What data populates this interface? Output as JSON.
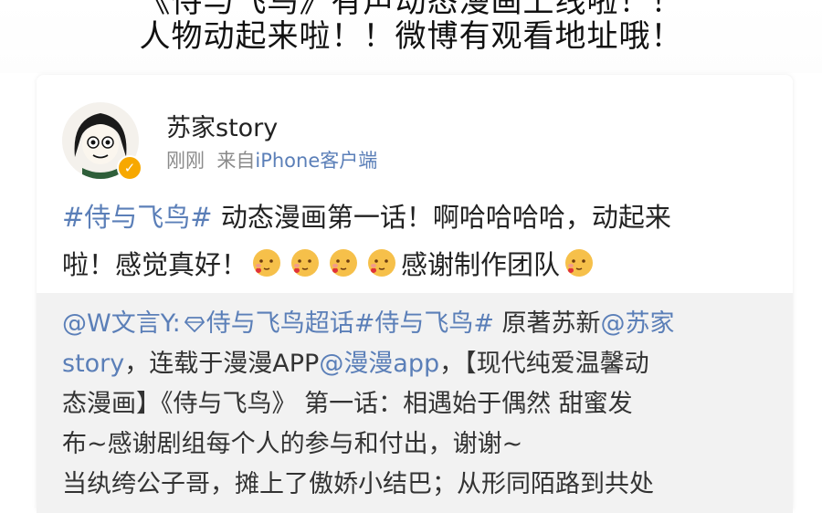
{
  "banner": {
    "line1": "《侍与飞鸟》有声动态漫画上线啦！！",
    "line2": "人物动起来啦！！微博有观看地址哦！"
  },
  "post": {
    "username": "苏家story",
    "time": "刚刚",
    "source_prefix": "来自",
    "source": "iPhone客户端",
    "topic": "#侍与飞鸟#",
    "text_1": " 动态漫画第一话！啊哈哈哈哈，动起来",
    "text_2": "啦！感觉真好！",
    "text_3": "感谢制作团队",
    "emoji_icon": "face-with-heart-emoji"
  },
  "repost": {
    "author": "@W文言Y:",
    "supertopic_icon": "diamond-icon",
    "supertopic": "侍与飞鸟超话",
    "topic": "#侍与飞鸟#",
    "text_1": " 原著苏新",
    "mention_1": "@苏家",
    "mention_1b": "story",
    "text_2": "，连载于漫漫APP",
    "mention_2": "@漫漫app",
    "text_3": "，【现代纯爱温馨动",
    "line_3": "态漫画】《侍与飞鸟》 第一话：相遇始于偶然 甜蜜发",
    "line_4": "布~感谢剧组每个人的参与和付出，谢谢~",
    "line_5": "当纨绔公子哥，摊上了傲娇小结巴；从形同陌路到共处"
  },
  "colors": {
    "link": "#5b7fb8",
    "verified": "#f7a800",
    "repost_bg": "#f2f2f2"
  }
}
